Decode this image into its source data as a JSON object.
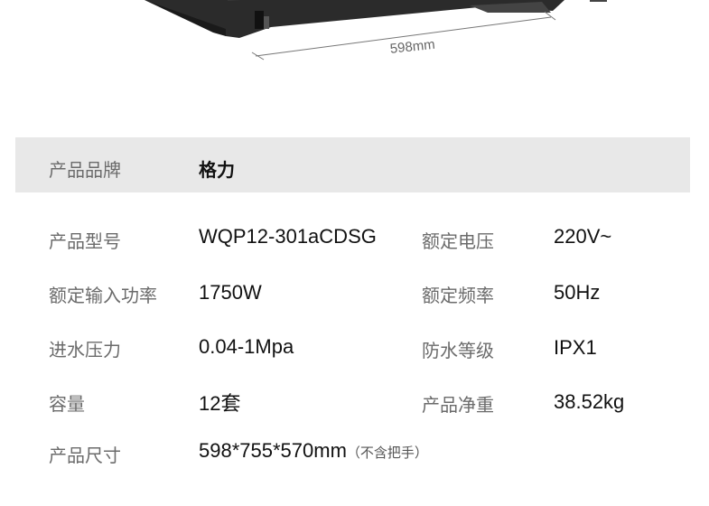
{
  "product_image": {
    "dimension_label": "598mm"
  },
  "brand": {
    "label": "产品品牌",
    "value": "格力"
  },
  "specs": {
    "model_label": "产品型号",
    "model_value": "WQP12-301aCDSG",
    "voltage_label": "额定电压",
    "voltage_value": "220V~",
    "input_power_label": "额定输入功率",
    "input_power_value": "1750W",
    "frequency_label": "额定频率",
    "frequency_value": "50Hz",
    "water_pressure_label": "进水压力",
    "water_pressure_value": "0.04-1Mpa",
    "waterproof_label": "防水等级",
    "waterproof_value": "IPX1",
    "capacity_label": "容量",
    "capacity_value": "12套",
    "net_weight_label": "产品净重",
    "net_weight_value": "38.52kg",
    "size_label": "产品尺寸",
    "size_value": "598*755*570mm",
    "size_note": "（不含把手）"
  }
}
